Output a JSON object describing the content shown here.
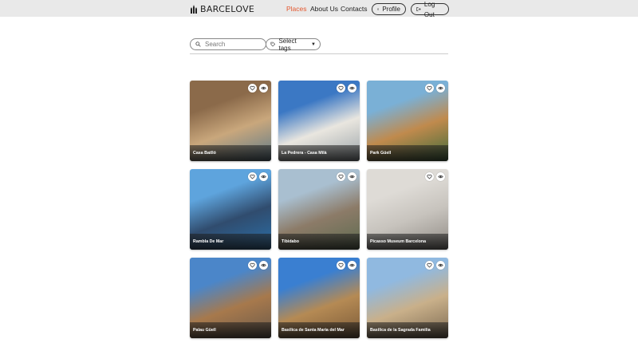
{
  "header": {
    "logo_text": "BARCELOVE",
    "nav": [
      {
        "label": "Places",
        "active": true
      },
      {
        "label": "About Us",
        "active": false
      },
      {
        "label": "Contacts",
        "active": false
      }
    ],
    "profile_label": "Profile",
    "logout_label": "Log Out",
    "active_color": "#e4572e"
  },
  "filters": {
    "search_placeholder": "Search",
    "tags_label": "Select tags"
  },
  "places": [
    {
      "name": "Casa Batlló",
      "palette": [
        "#8b6a4a",
        "#c9a77c",
        "#5c7a8a"
      ]
    },
    {
      "name": "La Pedrera - Casa Milà",
      "palette": [
        "#3b78c4",
        "#e9e6df",
        "#9aa3a8"
      ]
    },
    {
      "name": "Park Güell",
      "palette": [
        "#7ab0d6",
        "#c08a4d",
        "#3f6b3a"
      ]
    },
    {
      "name": "Rambla De Mar",
      "palette": [
        "#5ea4dd",
        "#304c6e",
        "#2a6fa8"
      ]
    },
    {
      "name": "Tibidabo",
      "palette": [
        "#a9bfd0",
        "#8c7b68",
        "#5c6b4f"
      ]
    },
    {
      "name": "Picasso Museum Barcelona",
      "palette": [
        "#dedbd6",
        "#c7c3bd",
        "#8f8a84"
      ]
    },
    {
      "name": "Palau Güell",
      "palette": [
        "#4b86c9",
        "#a7794c",
        "#6b5a4a"
      ]
    },
    {
      "name": "Basilica de Santa Maria del Mar",
      "palette": [
        "#3a7fd1",
        "#b58a54",
        "#7a5a38"
      ]
    },
    {
      "name": "Basilica de la Sagrada Familia",
      "palette": [
        "#90b9e0",
        "#c9b08a",
        "#7d6a52"
      ]
    }
  ]
}
